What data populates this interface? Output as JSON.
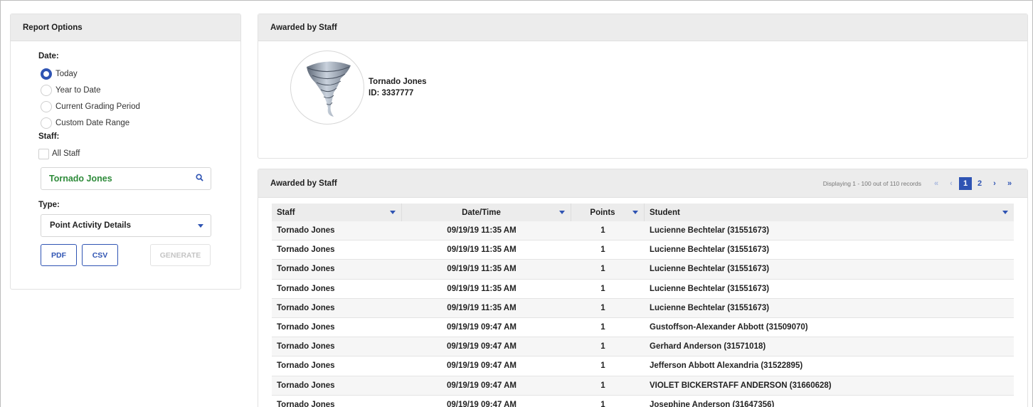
{
  "report_options": {
    "title": "Report Options",
    "date_label": "Date:",
    "date_options": [
      {
        "label": "Today",
        "checked": true
      },
      {
        "label": "Year to Date",
        "checked": false
      },
      {
        "label": "Current Grading Period",
        "checked": false
      },
      {
        "label": "Custom Date Range",
        "checked": false
      }
    ],
    "staff_label": "Staff:",
    "all_staff_label": "All Staff",
    "staff_search_value": "Tornado Jones",
    "type_label": "Type:",
    "type_selected": "Point Activity Details",
    "pdf_label": "PDF",
    "csv_label": "CSV",
    "generate_label": "GENERATE"
  },
  "profile": {
    "title": "Awarded by Staff",
    "name": "Tornado Jones",
    "id_text": "ID: 3337777"
  },
  "table": {
    "title": "Awarded by Staff",
    "pager_info": "Displaying 1 - 100 out of 110 records",
    "pages": [
      "1",
      "2"
    ],
    "columns": [
      "Staff",
      "Date/Time",
      "Points",
      "Student"
    ],
    "rows": [
      [
        "Tornado Jones",
        "09/19/19 11:35 AM",
        "1",
        "Lucienne Bechtelar (31551673)"
      ],
      [
        "Tornado Jones",
        "09/19/19 11:35 AM",
        "1",
        "Lucienne Bechtelar (31551673)"
      ],
      [
        "Tornado Jones",
        "09/19/19 11:35 AM",
        "1",
        "Lucienne Bechtelar (31551673)"
      ],
      [
        "Tornado Jones",
        "09/19/19 11:35 AM",
        "1",
        "Lucienne Bechtelar (31551673)"
      ],
      [
        "Tornado Jones",
        "09/19/19 11:35 AM",
        "1",
        "Lucienne Bechtelar (31551673)"
      ],
      [
        "Tornado Jones",
        "09/19/19 09:47 AM",
        "1",
        "Gustoffson-Alexander Abbott (31509070)"
      ],
      [
        "Tornado Jones",
        "09/19/19 09:47 AM",
        "1",
        "Gerhard Anderson (31571018)"
      ],
      [
        "Tornado Jones",
        "09/19/19 09:47 AM",
        "1",
        "Jefferson Abbott Alexandria (31522895)"
      ],
      [
        "Tornado Jones",
        "09/19/19 09:47 AM",
        "1",
        "VIOLET BICKERSTAFF ANDERSON (31660628)"
      ],
      [
        "Tornado Jones",
        "09/19/19 09:47 AM",
        "1",
        "Josephine Anderson (31647356)"
      ]
    ]
  },
  "colors": {
    "accent": "#2f54b3",
    "search_text": "#2e8b3a",
    "header_bg": "#ececec"
  }
}
